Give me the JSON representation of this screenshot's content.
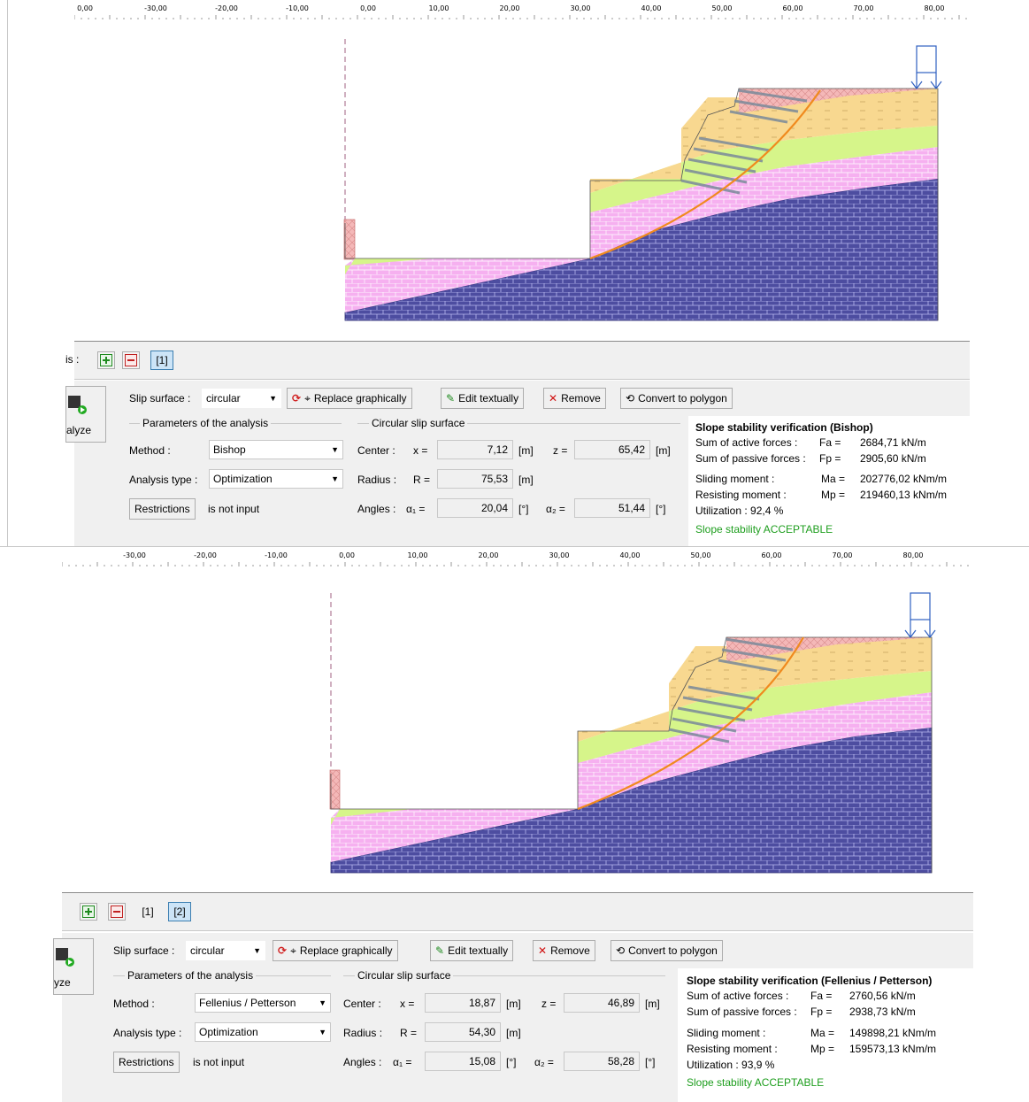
{
  "ruler_ticks": [
    "-30,00",
    "-20,00",
    "-10,00",
    "0,00",
    "10,00",
    "20,00",
    "30,00",
    "40,00",
    "50,00",
    "60,00",
    "70,00",
    "80,00"
  ],
  "ruler_first_label": "0,00",
  "colors": {
    "bedrock": "#4d4da0",
    "pink": "#f6b0f0",
    "green": "#d6f58a",
    "yellow": "#f8d890",
    "red_top": "#f4b8b8",
    "slip": "#f08a1e",
    "load": "#3060c0",
    "ok": "#1e9e1e"
  },
  "panes": [
    {
      "toolbar": {
        "prefix": "is :",
        "stages": [
          "[1]"
        ],
        "selected_stage": 0
      },
      "analyze_label": "alyze",
      "slip_surface_label": "Slip surface :",
      "slip_surface_value": "circular",
      "buttons": {
        "replace": "Replace graphically",
        "edit": "Edit textually",
        "remove": "Remove",
        "convert": "Convert to polygon",
        "restrictions": "Restrictions"
      },
      "params_title": "Parameters of the analysis",
      "method_label": "Method :",
      "method_value": "Bishop",
      "analysis_type_label": "Analysis type :",
      "analysis_type_value": "Optimization",
      "restrictions_status": "is not input",
      "circle_title": "Circular slip surface",
      "center_label": "Center :",
      "x_label": "x =",
      "x_value": "7,12",
      "z_label": "z =",
      "z_value": "65,42",
      "radius_label": "Radius :",
      "r_label": "R =",
      "r_value": "75,53",
      "angles_label": "Angles :",
      "a1_label": "α₁ =",
      "a1_value": "20,04",
      "a2_label": "α₂ =",
      "a2_value": "51,44",
      "unit_m": "[m]",
      "unit_deg": "[°]",
      "results": {
        "title": "Slope stability verification (Bishop)",
        "active_label": "Sum of active forces :",
        "active_sym": "Fa =",
        "active_val": "2684,71  kN/m",
        "passive_label": "Sum of passive forces :",
        "passive_sym": "Fp =",
        "passive_val": "2905,60  kN/m",
        "sliding_label": "Sliding moment :",
        "sliding_sym": "Ma =",
        "sliding_val": "202776,02  kNm/m",
        "resisting_label": "Resisting moment :",
        "resisting_sym": "Mp =",
        "resisting_val": "219460,13  kNm/m",
        "utilization": "Utilization :  92,4  %",
        "verdict": "Slope stability ACCEPTABLE"
      }
    },
    {
      "toolbar": {
        "prefix": "",
        "stages": [
          "[1]",
          "[2]"
        ],
        "selected_stage": 1
      },
      "analyze_label": "yze",
      "slip_surface_label": "Slip surface :",
      "slip_surface_value": "circular",
      "buttons": {
        "replace": "Replace graphically",
        "edit": "Edit textually",
        "remove": "Remove",
        "convert": "Convert to polygon",
        "restrictions": "Restrictions"
      },
      "params_title": "Parameters of the analysis",
      "method_label": "Method :",
      "method_value": "Fellenius / Petterson",
      "analysis_type_label": "Analysis type :",
      "analysis_type_value": "Optimization",
      "restrictions_status": "is not input",
      "circle_title": "Circular slip surface",
      "center_label": "Center :",
      "x_label": "x =",
      "x_value": "18,87",
      "z_label": "z =",
      "z_value": "46,89",
      "radius_label": "Radius :",
      "r_label": "R =",
      "r_value": "54,30",
      "angles_label": "Angles :",
      "a1_label": "α₁ =",
      "a1_value": "15,08",
      "a2_label": "α₂ =",
      "a2_value": "58,28",
      "unit_m": "[m]",
      "unit_deg": "[°]",
      "results": {
        "title": "Slope stability verification (Fellenius / Petterson)",
        "active_label": "Sum of active forces :",
        "active_sym": "Fa =",
        "active_val": "2760,56  kN/m",
        "passive_label": "Sum of passive forces :",
        "passive_sym": "Fp =",
        "passive_val": "2938,73  kN/m",
        "sliding_label": "Sliding moment :",
        "sliding_sym": "Ma =",
        "sliding_val": "149898,21  kNm/m",
        "resisting_label": "Resisting moment :",
        "resisting_sym": "Mp =",
        "resisting_val": "159573,13  kNm/m",
        "utilization": "Utilization :  93,9  %",
        "verdict": "Slope stability ACCEPTABLE"
      }
    }
  ]
}
